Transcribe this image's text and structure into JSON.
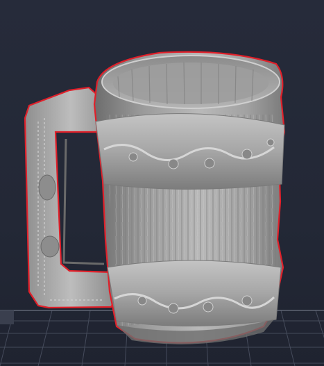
{
  "viewport": {
    "background": "#232836",
    "grid_color": "#4a5060",
    "grid_major_color": "#6a7080"
  },
  "model": {
    "name": "tankard-mug-icon",
    "body_color": "#a8a8a8",
    "shadow_color": "#5e5e5e",
    "highlight_color": "#d2d2d2",
    "outline_color": "#e0202a",
    "selected": true
  }
}
